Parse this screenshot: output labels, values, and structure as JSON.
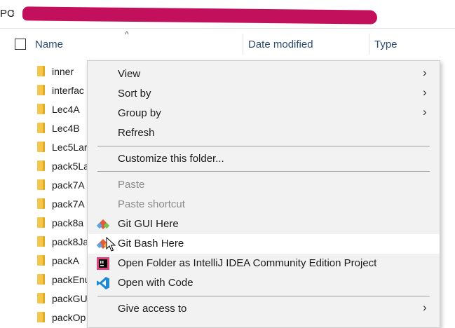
{
  "address": {
    "pc_label": "PC",
    "separator": "›"
  },
  "columns": {
    "name": "Name",
    "date_modified": "Date modified",
    "type": "Type"
  },
  "files": [
    "inner",
    "interfac",
    "Lec4A",
    "Lec4B",
    "Lec5Lar",
    "pack5La",
    "pack7A",
    "pack7A",
    "pack8a",
    "pack8Ja",
    "packA",
    "packEnu",
    "packGU",
    "packOp"
  ],
  "context_menu": {
    "items": [
      {
        "label": "View",
        "submenu": true
      },
      {
        "label": "Sort by",
        "submenu": true
      },
      {
        "label": "Group by",
        "submenu": true
      },
      {
        "label": "Refresh"
      },
      {
        "label": "Customize this folder..."
      },
      {
        "label": "Paste",
        "disabled": true
      },
      {
        "label": "Paste shortcut",
        "disabled": true
      },
      {
        "label": "Git GUI Here",
        "icon": "git-gui-icon"
      },
      {
        "label": "Git Bash Here",
        "icon": "git-bash-icon",
        "hover": true
      },
      {
        "label": "Open Folder as IntelliJ IDEA Community Edition Project",
        "icon": "intellij-icon"
      },
      {
        "label": "Open with Code",
        "icon": "vscode-icon"
      },
      {
        "label": "Give access to",
        "submenu": true
      }
    ]
  },
  "colors": {
    "redaction": "#c3105c",
    "menu_bg": "#f2f2f2",
    "folder": "#f4c64b",
    "header_text": "#2b4b6f"
  }
}
